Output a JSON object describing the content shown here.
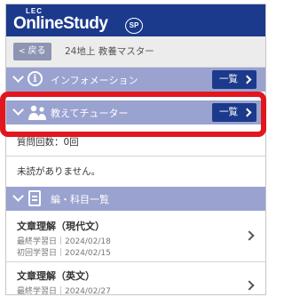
{
  "header": {
    "logo_top": "LEC",
    "logo_main": "OnlineStudy",
    "logo_badge": "SP"
  },
  "subbar": {
    "back_label": "戻る",
    "course_title": "24地上 教養マスター"
  },
  "sections": {
    "info": {
      "label": "インフォメーション",
      "list_label": "一覧"
    },
    "tutor": {
      "label": "教えてチューター",
      "list_label": "一覧",
      "question_count": "質問回数：0回",
      "unread": "未読がありません。"
    },
    "subjects": {
      "label": "編・科目一覧"
    }
  },
  "subject_list": [
    {
      "title": "文章理解（現代文）",
      "last": "最終学習日｜2024/02/18",
      "first": "初回学習日｜2024/02/15"
    },
    {
      "title": "文章理解（英文）",
      "last": "最終学習日｜2024/02/27"
    }
  ],
  "colors": {
    "header": "#1c3a8c",
    "section_bar": "#9aa2cf",
    "highlight": "#e2161e"
  },
  "icons": [
    "info-icon",
    "people-icon",
    "book-icon",
    "chevron-right-icon",
    "chevron-down-icon"
  ]
}
